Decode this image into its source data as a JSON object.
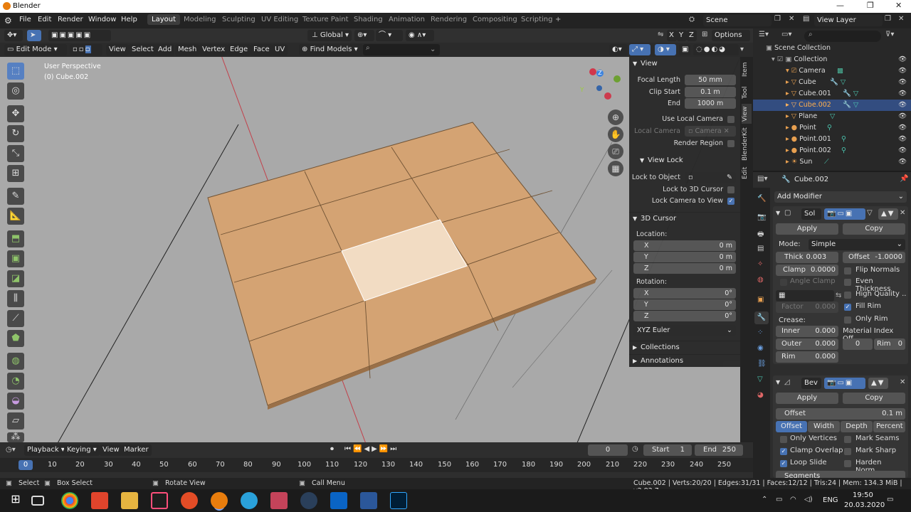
{
  "window": {
    "title": "Blender"
  },
  "menus": [
    "File",
    "Edit",
    "Render",
    "Window",
    "Help"
  ],
  "workspaces": [
    "Layout",
    "Modeling",
    "Sculpting",
    "UV Editing",
    "Texture Paint",
    "Shading",
    "Animation",
    "Rendering",
    "Compositing",
    "Scripting"
  ],
  "topbar": {
    "scene": "Scene",
    "view_layer": "View Layer"
  },
  "header": {
    "orientation": "Global",
    "options": "Options",
    "mode": "Edit Mode",
    "menu": [
      "View",
      "Select",
      "Add",
      "Mesh",
      "Vertex",
      "Edge",
      "Face",
      "UV"
    ],
    "find_models": "Find Models",
    "axes": [
      "X",
      "Y",
      "Z"
    ]
  },
  "viewport": {
    "perspective": "User Perspective",
    "object": "(0) Cube.002"
  },
  "npanel": {
    "view_header": "View",
    "focal_length_label": "Focal Length",
    "focal_length": "50 mm",
    "clip_start_label": "Clip Start",
    "clip_start": "0.1 m",
    "end_label": "End",
    "end": "1000 m",
    "use_local_camera": "Use Local Camera",
    "local_camera_label": "Local Camera",
    "local_camera_placeholder": "Camera",
    "render_region": "Render Region",
    "view_lock_header": "View Lock",
    "lock_to_object": "Lock to Object",
    "lock_to_3d_cursor": "Lock to 3D Cursor",
    "lock_camera_to_view": "Lock Camera to View",
    "cursor_header": "3D Cursor",
    "location": "Location:",
    "loc": [
      {
        "axis": "X",
        "val": "0 m"
      },
      {
        "axis": "Y",
        "val": "0 m"
      },
      {
        "axis": "Z",
        "val": "0 m"
      }
    ],
    "rotation": "Rotation:",
    "rot": [
      {
        "axis": "X",
        "val": "0°"
      },
      {
        "axis": "Y",
        "val": "0°"
      },
      {
        "axis": "Z",
        "val": "0°"
      }
    ],
    "rotation_mode": "XYZ Euler",
    "collections": "Collections",
    "annotations": "Annotations",
    "tabs": [
      "Item",
      "Tool",
      "View",
      "BlenderKit",
      "Edit"
    ]
  },
  "outliner": {
    "items": [
      {
        "name": "Scene Collection",
        "indent": 0
      },
      {
        "name": "Collection",
        "indent": 1
      },
      {
        "name": "Camera",
        "indent": 2
      },
      {
        "name": "Cube",
        "indent": 2
      },
      {
        "name": "Cube.001",
        "indent": 2
      },
      {
        "name": "Cube.002",
        "indent": 2,
        "selected": true
      },
      {
        "name": "Plane",
        "indent": 2
      },
      {
        "name": "Point",
        "indent": 2
      },
      {
        "name": "Point.001",
        "indent": 2
      },
      {
        "name": "Point.002",
        "indent": 2
      },
      {
        "name": "Sun",
        "indent": 2
      }
    ]
  },
  "properties": {
    "object": "Cube.002",
    "add_modifier": "Add Modifier",
    "mod1": {
      "name": "Sol",
      "apply": "Apply",
      "copy": "Copy",
      "mode_label": "Mode:",
      "mode": "Simple",
      "thick_label": "Thick",
      "thick": "0.003 m",
      "offset_label": "Offset",
      "offset": "-1.0000",
      "clamp_label": "Clamp",
      "clamp": "0.0000",
      "flip_normals": "Flip Normals",
      "angle_clamp": "Angle Clamp",
      "even_thickness": "Even Thickness",
      "high_quality": "High Quality ..",
      "factor_label": "Factor",
      "factor": "0.000",
      "fill_rim": "Fill Rim",
      "only_rim": "Only Rim",
      "crease": "Crease:",
      "inner_label": "Inner",
      "inner": "0.000",
      "outer_label": "Outer",
      "outer": "0.000",
      "rim_label": "Rim",
      "rim": "0.000",
      "mat_index": "Material Index Off..",
      "mat_val": "0",
      "mat_rim_label": "Rim",
      "mat_rim": "0"
    },
    "mod2": {
      "name": "Bev",
      "apply": "Apply",
      "copy": "Copy",
      "offset_label": "Offset",
      "offset": "0.1 m",
      "tabs": [
        "Offset",
        "Width",
        "Depth",
        "Percent"
      ],
      "only_vertices": "Only Vertices",
      "mark_seams": "Mark Seams",
      "clamp_overlap": "Clamp Overlap",
      "mark_sharp": "Mark Sharp",
      "loop_slide": "Loop Slide",
      "harden_normals": "Harden Norm...",
      "segments": "Segments"
    }
  },
  "timeline": {
    "menu": [
      "Playback",
      "Keying",
      "View",
      "Marker"
    ],
    "current_frame": "0",
    "start_label": "Start",
    "start": "1",
    "end_label": "End",
    "end": "250",
    "ticks": [
      "0",
      "10",
      "20",
      "30",
      "40",
      "50",
      "60",
      "70",
      "80",
      "90",
      "100",
      "110",
      "120",
      "130",
      "140",
      "150",
      "160",
      "170",
      "180",
      "190",
      "200",
      "210",
      "220",
      "230",
      "240",
      "250"
    ]
  },
  "statusbar": {
    "select": "Select",
    "box_select": "Box Select",
    "rotate_view": "Rotate View",
    "call_menu": "Call Menu",
    "stats": "Cube.002 | Verts:20/20 | Edges:31/31 | Faces:12/12 | Tris:24 | Mem: 134.3 MiB | v2.82.7"
  },
  "taskbar": {
    "lang": "ENG",
    "time": "19:50",
    "date": "20.03.2020"
  },
  "colors": {
    "accent": "#4772b3",
    "plane": "#d4a373",
    "viewport_bg": "#a9a9a9"
  }
}
